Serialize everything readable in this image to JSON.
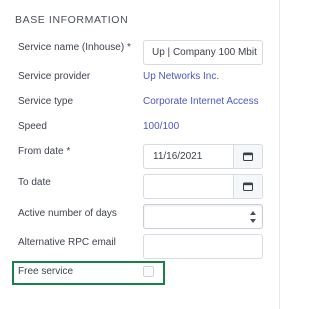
{
  "section": {
    "title": "BASE INFORMATION"
  },
  "fields": {
    "service_name": {
      "label": "Service name (Inhouse) *",
      "value": "Up | Company 100 Mbit"
    },
    "service_provider": {
      "label": "Service provider",
      "value": "Up Networks Inc."
    },
    "service_type": {
      "label": "Service type",
      "value": "Corporate Internet Access"
    },
    "speed": {
      "label": "Speed",
      "value": "100/100"
    },
    "from_date": {
      "label": "From date *",
      "value": "11/16/2021",
      "icon": "calendar-icon"
    },
    "to_date": {
      "label": "To date",
      "value": "",
      "icon": "calendar-icon"
    },
    "active_days": {
      "label": "Active number of days",
      "value": ""
    },
    "alt_rpc_email": {
      "label": "Alternative RPC email",
      "value": ""
    },
    "free_service": {
      "label": "Free service",
      "checked": false
    }
  },
  "colors": {
    "link": "#4b57c8",
    "highlight_border": "#1a7f4b",
    "label_text": "#3f4350"
  }
}
